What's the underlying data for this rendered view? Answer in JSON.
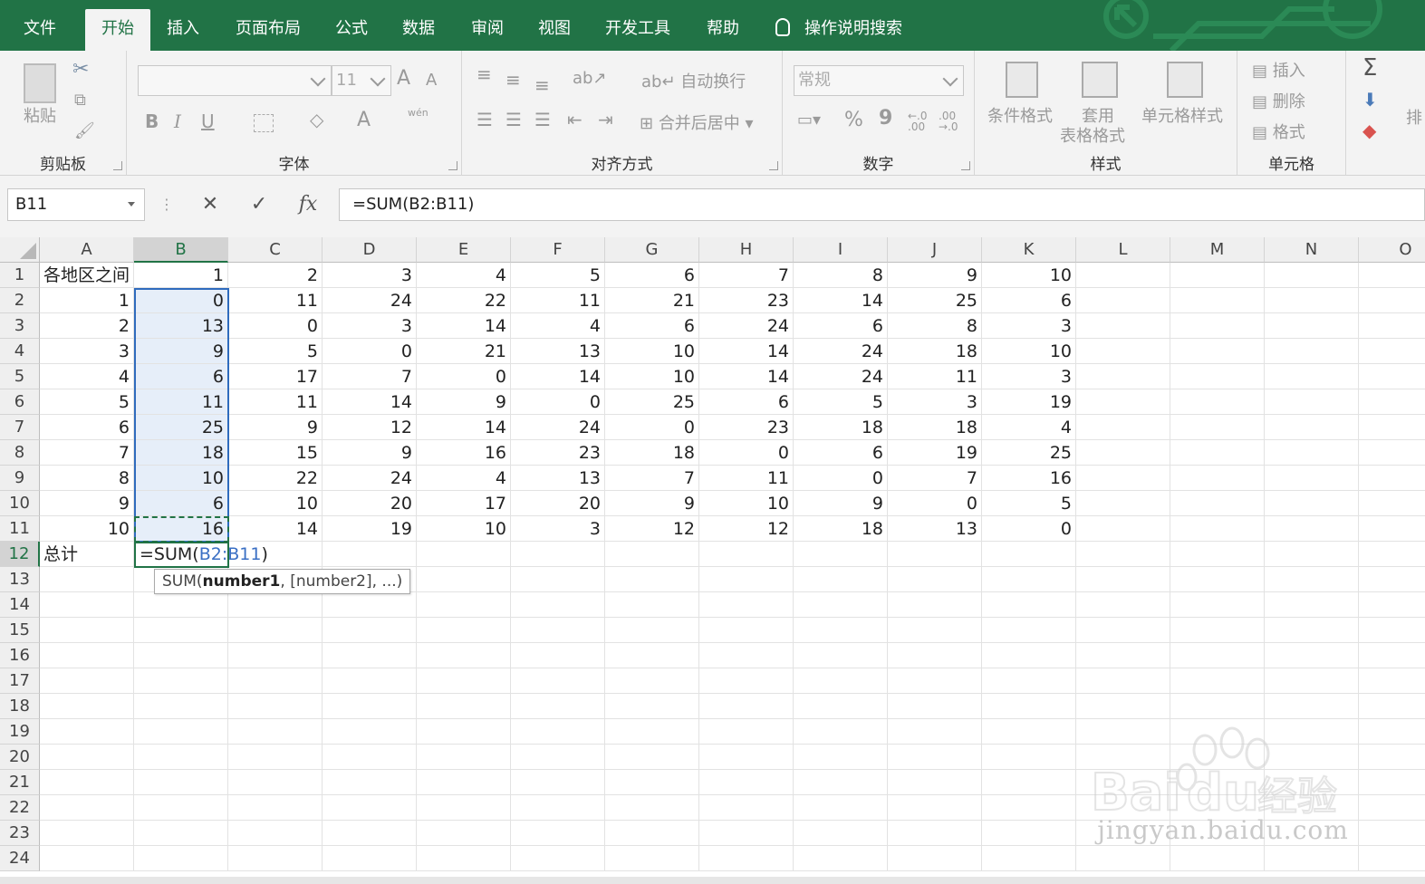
{
  "colors": {
    "accent": "#217346",
    "selection_fill": "#e6eef9",
    "selection_border": "#2f6bbd",
    "ref_color": "#3a6fc4"
  },
  "tabs": [
    "文件",
    "开始",
    "插入",
    "页面布局",
    "公式",
    "数据",
    "审阅",
    "视图",
    "开发工具",
    "帮助"
  ],
  "tell_me": "操作说明搜索",
  "ribbon": {
    "clipboard": {
      "label": "剪贴板",
      "paste": "粘贴"
    },
    "font": {
      "label": "字体",
      "size": "11",
      "bold": "B",
      "italic": "I",
      "underline": "U",
      "grow": "A",
      "shrink": "A",
      "phonetic": "wén"
    },
    "alignment": {
      "label": "对齐方式",
      "wrap": "自动换行",
      "merge": "合并后居中"
    },
    "number": {
      "label": "数字",
      "format": "常规",
      "percent": "%",
      "comma": "9",
      "inc_dec": "←.0 .00",
      "dec_dec": ".00 →.0"
    },
    "styles": {
      "label": "样式",
      "conditional": "条件格式",
      "table_line1": "套用",
      "table_line2": "表格格式",
      "cell_styles": "单元格样式"
    },
    "cells": {
      "label": "单元格",
      "insert": "插入",
      "delete": "删除",
      "format": "格式"
    },
    "editing": {
      "sum": "Σ",
      "sort_partial": "排"
    }
  },
  "formula_bar": {
    "name_box": "B11",
    "cancel": "✕",
    "enter": "✓",
    "fx": "fx",
    "formula": "=SUM(B2:B11)"
  },
  "columns": [
    "A",
    "B",
    "C",
    "D",
    "E",
    "F",
    "G",
    "H",
    "I",
    "J",
    "K",
    "L",
    "M",
    "N",
    "O"
  ],
  "rows": [
    "1",
    "2",
    "3",
    "4",
    "5",
    "6",
    "7",
    "8",
    "9",
    "10",
    "11",
    "12",
    "13",
    "14",
    "15",
    "16",
    "17",
    "18",
    "19",
    "20",
    "21",
    "22",
    "23",
    "24"
  ],
  "cells": [
    [
      "各地区之间",
      "1",
      "2",
      "3",
      "4",
      "5",
      "6",
      "7",
      "8",
      "9",
      "10"
    ],
    [
      "1",
      "0",
      "11",
      "24",
      "22",
      "11",
      "21",
      "23",
      "14",
      "25",
      "6"
    ],
    [
      "2",
      "13",
      "0",
      "3",
      "14",
      "4",
      "6",
      "24",
      "6",
      "8",
      "3"
    ],
    [
      "3",
      "9",
      "5",
      "0",
      "21",
      "13",
      "10",
      "14",
      "24",
      "18",
      "10"
    ],
    [
      "4",
      "6",
      "17",
      "7",
      "0",
      "14",
      "10",
      "14",
      "24",
      "11",
      "3"
    ],
    [
      "5",
      "11",
      "11",
      "14",
      "9",
      "0",
      "25",
      "6",
      "5",
      "3",
      "19"
    ],
    [
      "6",
      "25",
      "9",
      "12",
      "14",
      "24",
      "0",
      "23",
      "18",
      "18",
      "4"
    ],
    [
      "7",
      "18",
      "15",
      "9",
      "16",
      "23",
      "18",
      "0",
      "6",
      "19",
      "25"
    ],
    [
      "8",
      "10",
      "22",
      "24",
      "4",
      "13",
      "7",
      "11",
      "0",
      "7",
      "16"
    ],
    [
      "9",
      "6",
      "10",
      "20",
      "17",
      "20",
      "9",
      "10",
      "9",
      "0",
      "5"
    ],
    [
      "10",
      "16",
      "14",
      "19",
      "10",
      "3",
      "12",
      "12",
      "18",
      "13",
      "0"
    ]
  ],
  "total_label": "总计",
  "edit_cell": {
    "prefix": "=SUM(",
    "ref": "B2:B11",
    "suffix": ")"
  },
  "tooltip": {
    "fn": "SUM(",
    "arg1": "number1",
    ", rest": ", [number2], ...)"
  },
  "watermark": {
    "brand": "Bai",
    "brand2": "du",
    "cn": "经验",
    "url": "jingyan.baidu.com"
  }
}
